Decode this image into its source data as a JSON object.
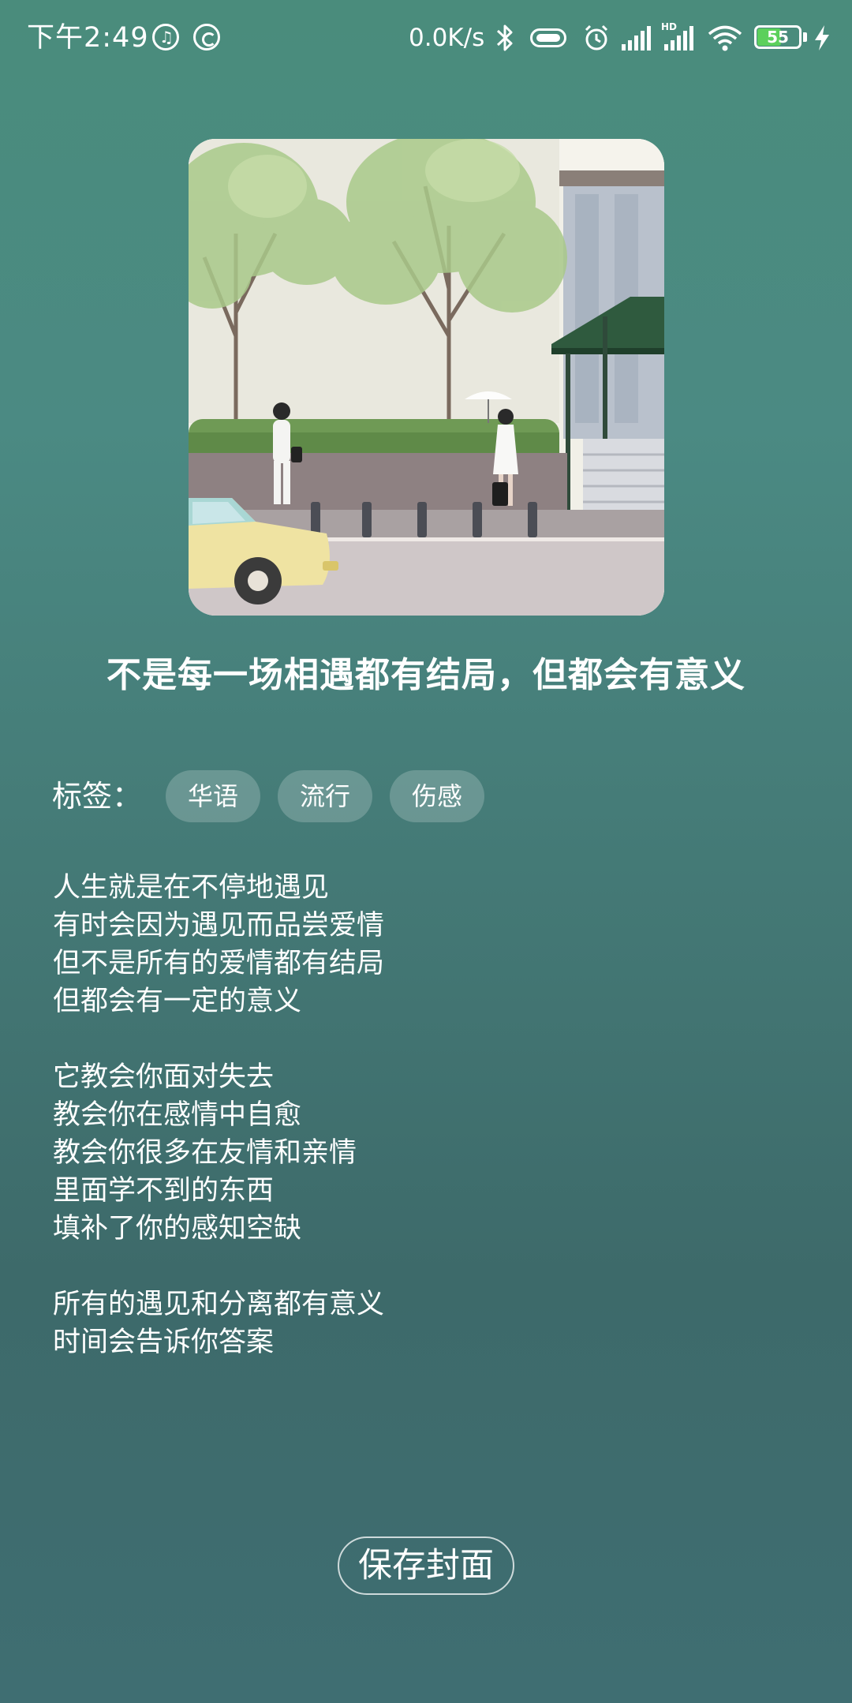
{
  "status_bar": {
    "time": "下午2:49",
    "network_speed": "0.0K/s",
    "battery_level": "55",
    "icons": [
      "music-note-icon",
      "sync-icon",
      "bluetooth-icon",
      "vibrate-icon",
      "alarm-icon",
      "signal-icon",
      "hd-signal-icon",
      "wifi-icon",
      "battery-icon",
      "charging-icon"
    ]
  },
  "cover": {
    "icon": "album-cover-illustration"
  },
  "song": {
    "title": "不是每一场相遇都有结局，但都会有意义"
  },
  "tags": {
    "label": "标签：",
    "items": [
      "华语",
      "流行",
      "伤感"
    ]
  },
  "lyrics": [
    [
      "人生就是在不停地遇见",
      "有时会因为遇见而品尝爱情",
      "但不是所有的爱情都有结局",
      "但都会有一定的意义"
    ],
    [
      "它教会你面对失去",
      "教会你在感情中自愈",
      "教会你很多在友情和亲情",
      "里面学不到的东西",
      "填补了你的感知空缺"
    ],
    [
      "所有的遇见和分离都有意义",
      "时间会告诉你答案"
    ]
  ],
  "actions": {
    "save_cover": "保存封面"
  },
  "colors": {
    "background_top": "#4a8c7c",
    "background_bottom": "#3d6a6a",
    "battery_fill": "#5cd05c"
  }
}
